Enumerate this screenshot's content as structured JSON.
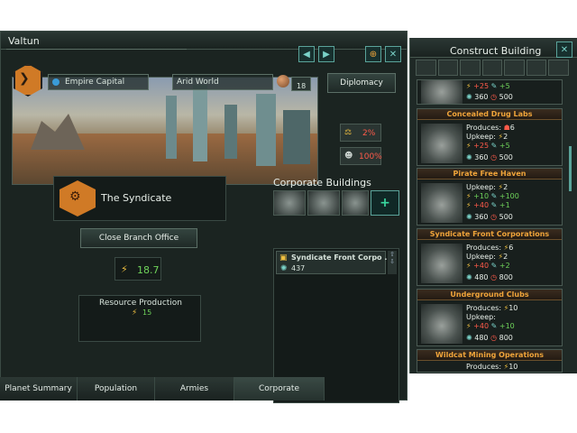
{
  "planet_name": "Valtun",
  "banner": {
    "capital_label": "Empire Capital",
    "world_label": "Arid World",
    "pop_count": "18"
  },
  "diplomacy_label": "Diplomacy",
  "stats": {
    "crime": "2%",
    "stability": "100%"
  },
  "syndicate": {
    "name": "The Syndicate",
    "close_label": "Close Branch Office",
    "value": "18.7"
  },
  "resource": {
    "title": "Resource Production",
    "value": "15"
  },
  "corporate": {
    "title": "Corporate Buildings",
    "add_symbol": "+"
  },
  "building_item": {
    "name": "Syndicate Front Corpo ...",
    "cost": "437"
  },
  "tabs": [
    "Planet Summary",
    "Population",
    "Armies",
    "Corporate"
  ],
  "construct": {
    "title": "Construct Building",
    "top_card": {
      "a": "+25",
      "b": "+5",
      "c": "360",
      "d": "500"
    },
    "cards": [
      {
        "title": "Concealed Drug Labs",
        "produces": "Produces:",
        "prod_val": "6",
        "upkeep": "Upkeep:",
        "upk_val": "2",
        "l3a": "+25",
        "l3b": "+5",
        "cost1": "360",
        "cost2": "500"
      },
      {
        "title": "Pirate Free Haven",
        "produces": "Upkeep:",
        "prod_val": "2",
        "upkeep": "+10",
        "upk_val": "+100",
        "l3a": "+40",
        "l3b": "+1",
        "cost1": "360",
        "cost2": "500"
      },
      {
        "title": "Syndicate Front Corporations",
        "produces": "Produces:",
        "prod_val": "6",
        "upkeep": "Upkeep:",
        "upk_val": "2",
        "l3a": "+40",
        "l3b": "+2",
        "cost1": "480",
        "cost2": "800"
      },
      {
        "title": "Underground Clubs",
        "produces": "Produces:",
        "prod_val": "10",
        "upkeep": "Upkeep:",
        "upk_val": "",
        "l3a": "+40",
        "l3b": "+10",
        "cost1": "480",
        "cost2": "800"
      },
      {
        "title": "Wildcat Mining Operations",
        "produces": "Produces:",
        "prod_val": "10"
      }
    ]
  }
}
